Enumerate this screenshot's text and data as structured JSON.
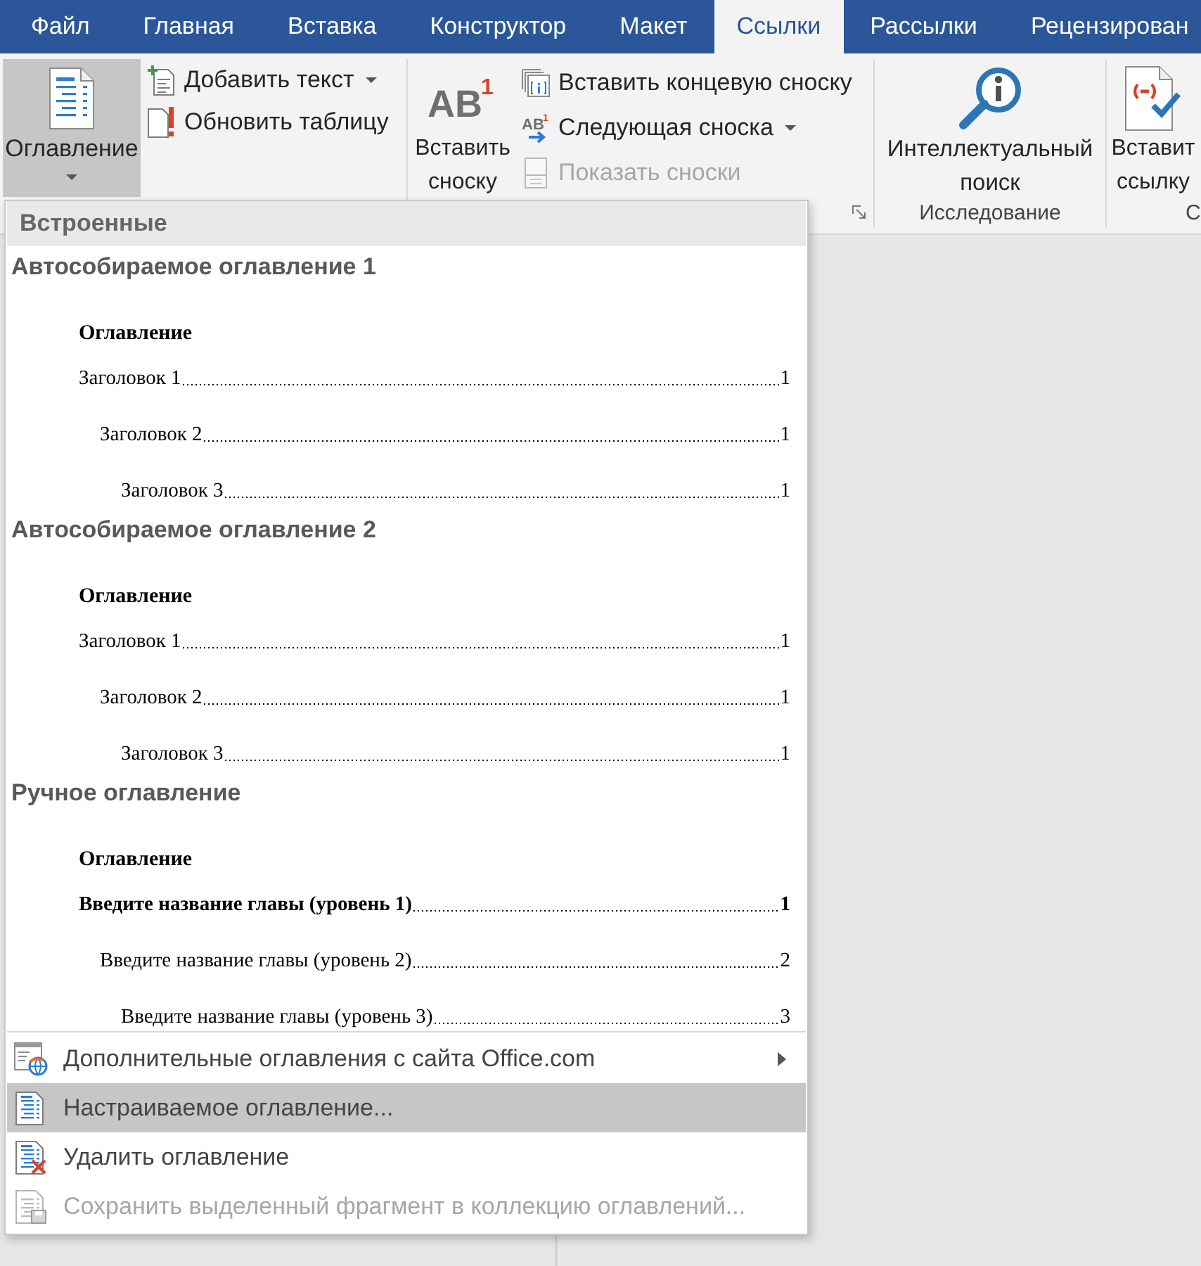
{
  "tabs": [
    {
      "label": "Файл",
      "selected": false
    },
    {
      "label": "Главная",
      "selected": false
    },
    {
      "label": "Вставка",
      "selected": false
    },
    {
      "label": "Конструктор",
      "selected": false
    },
    {
      "label": "Макет",
      "selected": false
    },
    {
      "label": "Ссылки",
      "selected": true
    },
    {
      "label": "Рассылки",
      "selected": false
    },
    {
      "label": "Рецензирован",
      "selected": false
    }
  ],
  "ribbon": {
    "table_of_contents": {
      "toc_button": {
        "label": "Оглавление",
        "pressed": true,
        "dropdown": true
      },
      "add_text": {
        "label": "Добавить текст",
        "dropdown": true,
        "disabled": false
      },
      "update_table": {
        "label": "Обновить таблицу",
        "dropdown": false,
        "disabled": false
      }
    },
    "footnotes": {
      "insert_footnote": {
        "label": "Вставить сноску",
        "icon_text": "AB",
        "icon_mark": "1"
      },
      "insert_endnote": {
        "label": "Вставить концевую сноску",
        "dropdown": false,
        "disabled": false
      },
      "next_footnote": {
        "label": "Следующая сноска",
        "icon_text": "AB",
        "icon_mark": "1",
        "dropdown": true,
        "disabled": false
      },
      "show_notes": {
        "label": "Показать сноски",
        "dropdown": false,
        "disabled": true
      }
    },
    "research": {
      "smart_lookup": {
        "label": "Интеллектуальный поиск"
      },
      "label": "Исследование"
    },
    "citations": {
      "insert_citation": {
        "label": "Вставит ссылку"
      },
      "label": "С"
    }
  },
  "toc_menu": {
    "header": "Встроенные",
    "gallery": [
      {
        "title": "Автособираемое оглавление 1",
        "preview": {
          "heading": "Оглавление",
          "entries": [
            {
              "text": "Заголовок 1",
              "page": "1",
              "bold": false,
              "children": [
                {
                  "text": "Заголовок 2",
                  "page": "1",
                  "bold": false,
                  "children": [
                    {
                      "text": "Заголовок 3",
                      "page": "1",
                      "bold": false
                    }
                  ]
                }
              ]
            }
          ]
        }
      },
      {
        "title": "Автособираемое оглавление 2",
        "preview": {
          "heading": "Оглавление",
          "entries": [
            {
              "text": "Заголовок 1",
              "page": "1",
              "bold": false,
              "children": [
                {
                  "text": "Заголовок 2",
                  "page": "1",
                  "bold": false,
                  "children": [
                    {
                      "text": "Заголовок 3",
                      "page": "1",
                      "bold": false
                    }
                  ]
                }
              ]
            }
          ]
        }
      },
      {
        "title": "Ручное оглавление",
        "preview": {
          "heading": "Оглавление",
          "entries": [
            {
              "text": "Введите название главы (уровень 1)",
              "page": "1",
              "bold": true,
              "children": [
                {
                  "text": "Введите название главы (уровень 2)",
                  "page": "2",
                  "bold": false,
                  "children": [
                    {
                      "text": "Введите название главы (уровень 3)",
                      "page": "3",
                      "bold": false
                    }
                  ]
                }
              ]
            }
          ]
        }
      }
    ],
    "commands": [
      {
        "kind": "online",
        "label": "Дополнительные оглавления с сайта Office.com",
        "submenu": true,
        "selected": false,
        "disabled": false
      },
      {
        "kind": "custom",
        "label": "Настраиваемое оглавление...",
        "submenu": false,
        "selected": true,
        "disabled": false
      },
      {
        "kind": "remove",
        "label": "Удалить оглавление",
        "submenu": false,
        "selected": false,
        "disabled": false
      },
      {
        "kind": "save",
        "label": "Сохранить выделенный фрагмент в коллекцию оглавлений...",
        "submenu": false,
        "selected": false,
        "disabled": true
      }
    ]
  }
}
